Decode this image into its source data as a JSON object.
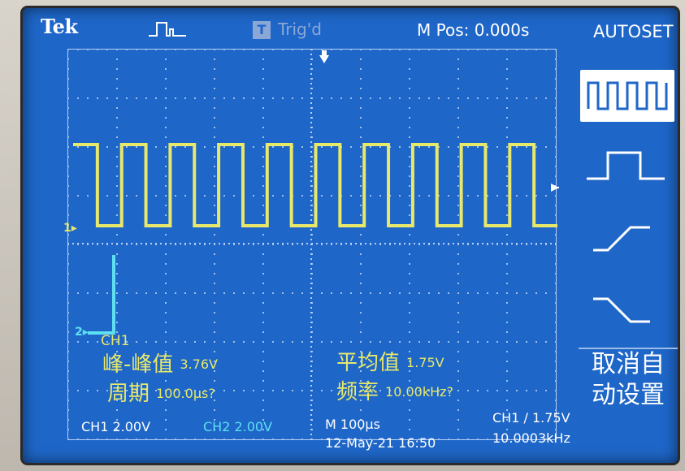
{
  "header": {
    "brand": "Tek",
    "trigger_icon_letter": "T",
    "trigger_status": "Trig'd",
    "horizontal_position": "M Pos: 0.000s",
    "menu_title": "AUTOSET"
  },
  "side_menu": {
    "options": [
      {
        "icon": "square-wave-icon",
        "selected": true
      },
      {
        "icon": "single-pulse-icon",
        "selected": false
      },
      {
        "icon": "rising-edge-icon",
        "selected": false
      },
      {
        "icon": "falling-edge-icon",
        "selected": false
      }
    ],
    "cancel_label_line1": "取消自",
    "cancel_label_line2": "动设置"
  },
  "measurements": {
    "source": "CH1",
    "peak_to_peak_label": "峰-峰值",
    "peak_to_peak_value": "3.76V",
    "mean_label": "平均值",
    "mean_value": "1.75V",
    "period_label": "周期",
    "period_value": "100.0μs?",
    "frequency_label": "频率",
    "frequency_value": "10.00kHz?"
  },
  "channel_markers": {
    "ch1": "1",
    "ch2": "2"
  },
  "status_bar": {
    "ch1_scale": "CH1  2.00V",
    "ch2_scale": "CH2  2.00V",
    "timebase": "M 100μs",
    "trigger_info": "CH1 ∕ 1.75V",
    "date_time": "12-May-21 16:50",
    "trigger_frequency": "10.0003kHz"
  },
  "colors": {
    "screen_bg": "#1e66c8",
    "ch1": "#e8e86a",
    "ch2": "#5ee0f0",
    "text": "#ffffff"
  }
}
